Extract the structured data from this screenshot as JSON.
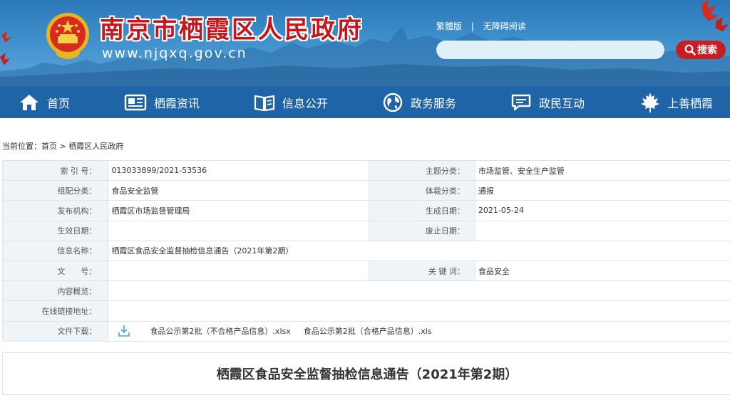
{
  "header": {
    "site_title": "南京市栖霞区人民政府",
    "site_url": "www.njqxq.gov.cn",
    "links": [
      "繁體版",
      "无障碍阅读"
    ],
    "link_separator": "|",
    "search_placeholder": "",
    "search_label": "搜索"
  },
  "nav": {
    "items": [
      {
        "label": "首页",
        "icon": "home-icon"
      },
      {
        "label": "栖霞资讯",
        "icon": "newspaper-icon"
      },
      {
        "label": "信息公开",
        "icon": "book-icon"
      },
      {
        "label": "政务服务",
        "icon": "globe-icon"
      },
      {
        "label": "政民互动",
        "icon": "chat-icon"
      },
      {
        "label": "上善栖霞",
        "icon": "maple-leaf-icon"
      }
    ]
  },
  "breadcrumb": {
    "prefix": "当前位置：",
    "home": "首页",
    "sep": ">",
    "current": "栖霞区人民政府"
  },
  "info": {
    "index_label": "索 引 号：",
    "index_value": "013033899/2021-53536",
    "topic_label": "主题分类：",
    "topic_value": "市场监管、安全生产监管",
    "group_label": "组配分类：",
    "group_value": "食品安全监管",
    "genre_label": "体裁分类：",
    "genre_value": "通报",
    "publisher_label": "发布机构：",
    "publisher_value": "栖霞区市场监督管理局",
    "created_label": "生成日期：",
    "created_value": "2021-05-24",
    "effective_label": "生效日期：",
    "effective_value": "",
    "abolish_label": "废止日期：",
    "abolish_value": "",
    "name_label": "信息名称：",
    "name_value": "栖霞区食品安全监督抽检信息通告（2021年第2期）",
    "docno_label": "文　　号：",
    "docno_value": "",
    "keyword_label": "关 键 词：",
    "keyword_value": "食品安全",
    "summary_label": "内容概览：",
    "summary_value": "",
    "link_label": "在线链接地址：",
    "link_value": "",
    "download_label": "文件下载：",
    "files": [
      "食品公示第2批（不合格产品信息）.xlsx",
      "食品公示第2批（合格产品信息）.xls"
    ]
  },
  "article": {
    "title": "栖霞区食品安全监督抽检信息通告（2021年第2期）"
  },
  "colors": {
    "header_blue": "#2b78b8",
    "nav_blue": "#1f64a6",
    "title_red": "#c4161c",
    "search_red": "#c81e23",
    "label_bg": "#eef4f8"
  }
}
